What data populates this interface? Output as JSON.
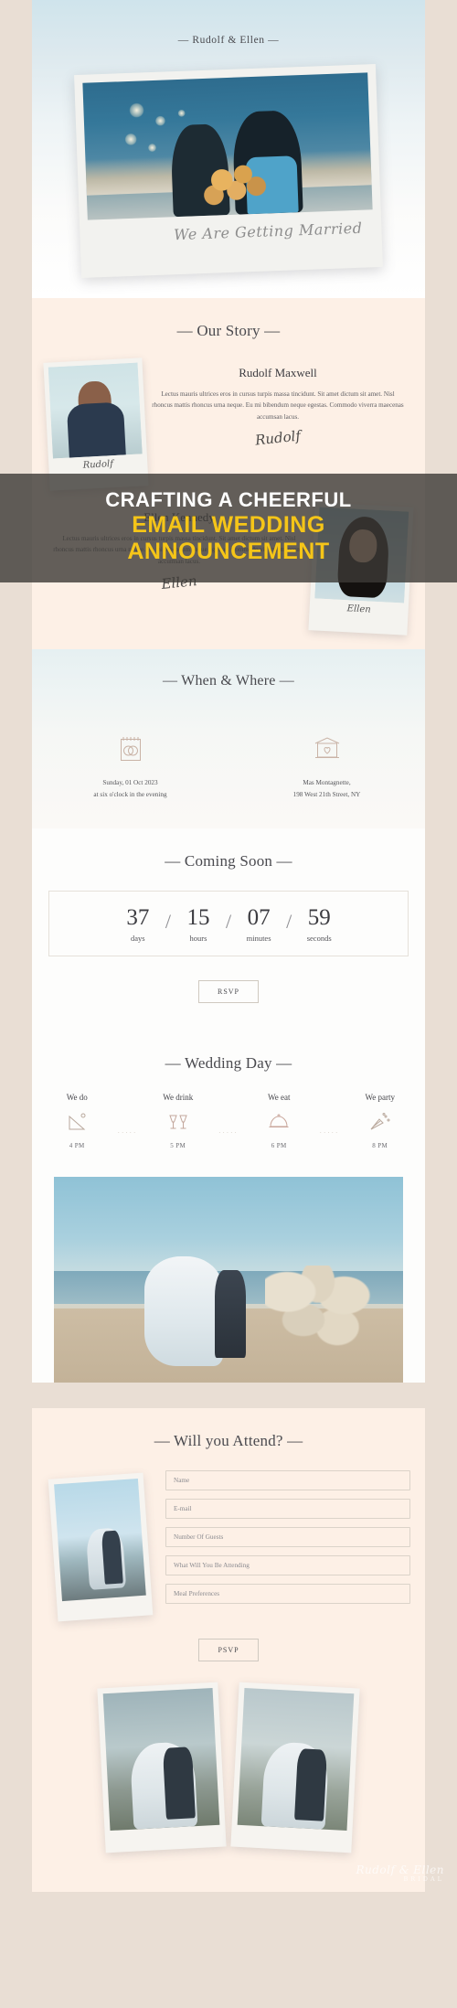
{
  "hero": {
    "title": "— Rudolf & Ellen —",
    "polaroid_caption": "We Are Getting Married"
  },
  "overlay_banner": {
    "line1": "CRAFTING A CHEERFUL",
    "line2": "EMAIL WEDDING",
    "line3": "ANNOUNCEMENT"
  },
  "story": {
    "heading": "— Our Story —",
    "people": [
      {
        "name": "Rudolf Maxwell",
        "bio": "Lectus mauris ultrices eros in cursus turpis massa tincidunt. Sit amet dictum sit amet. Nisl rhoncus mattis rhoncus urna neque. Eu mi bibendum neque egestas. Commodo viverra maecenas accumsan lacus.",
        "signature": "Rudolf",
        "photo_caption": "Rudolf"
      },
      {
        "name": "Ellen Kennedy",
        "bio": "Lectus mauris ultrices eros in cursus turpis massa tincidunt. Sit amet dictum sit amet. Nisl rhoncus mattis rhoncus urna neque. Eu mi bibendum neque egestas. Commodo viverra maecenas accumsan lacus.",
        "signature": "Ellen",
        "photo_caption": "Ellen"
      }
    ]
  },
  "when_where": {
    "heading": "— When & Where —",
    "date": {
      "icon": "calendar-rings-icon",
      "line1": "Sunday, 01 Oct 2023",
      "line2": "at six o'clock in the evening"
    },
    "venue": {
      "icon": "venue-heart-icon",
      "line1": "Mas Montagnette,",
      "line2": "198 West 21th Street, NY"
    }
  },
  "countdown": {
    "heading": "— Coming Soon —",
    "separator": "/",
    "units": [
      {
        "value": "37",
        "label": "days"
      },
      {
        "value": "15",
        "label": "hours"
      },
      {
        "value": "07",
        "label": "minutes"
      },
      {
        "value": "59",
        "label": "seconds"
      }
    ],
    "rsvp_label": "RSVP"
  },
  "wedding_day": {
    "heading": "— Wedding Day —",
    "items": [
      {
        "label": "We do",
        "icon": "arch-icon",
        "time": "4 PM"
      },
      {
        "label": "We drink",
        "icon": "cheers-icon",
        "time": "5 PM"
      },
      {
        "label": "We eat",
        "icon": "cloche-icon",
        "time": "6 PM"
      },
      {
        "label": "We party",
        "icon": "confetti-icon",
        "time": "8 PM"
      }
    ],
    "dots": "·····"
  },
  "attend": {
    "heading": "— Will you Attend? —",
    "fields": [
      {
        "name": "name-field",
        "placeholder": "Name",
        "value": ""
      },
      {
        "name": "email-field",
        "placeholder": "E-mail",
        "value": ""
      },
      {
        "name": "guests-field",
        "placeholder": "Number Of Guests",
        "value": ""
      },
      {
        "name": "attending-field",
        "placeholder": "What Will You Be Attending",
        "value": ""
      },
      {
        "name": "meal-preferences-field",
        "placeholder": "Meal Preferences",
        "value": ""
      }
    ],
    "submit_label": "PSVP"
  },
  "footer": {
    "watermark_script": "Rudolf & Ellen",
    "watermark_sub": "BRIDAL"
  },
  "colors": {
    "page_bg": "#e9ded4",
    "cream": "#fdf0e6",
    "accent_yellow": "#f5c518",
    "overlay": "rgba(60,58,54,0.80)",
    "text_dark": "#3c3c41"
  }
}
